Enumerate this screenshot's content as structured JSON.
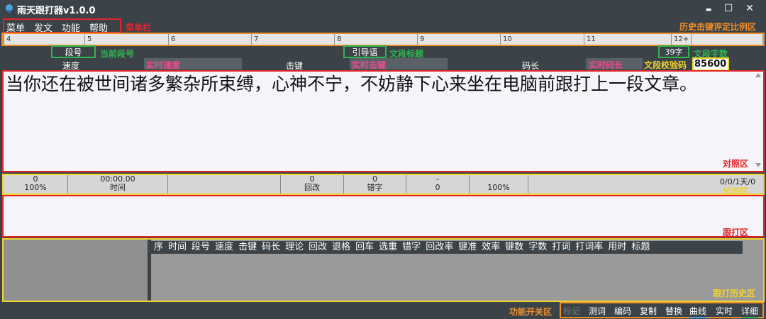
{
  "window": {
    "title": "雨天跟打器v1.0.0",
    "minimize": "▬",
    "maximize": "☐",
    "close": "✕",
    "menu_glyph": "▬"
  },
  "menu": {
    "items": [
      "菜单",
      "发文",
      "功能",
      "帮助"
    ]
  },
  "ruler": {
    "ticks": [
      "4",
      "5",
      "6",
      "7",
      "8",
      "9",
      "10",
      "11",
      "12+"
    ]
  },
  "info": {
    "segment_no": "段号",
    "guide": "引导语",
    "char_count": "39字",
    "check_code": "85600",
    "labels": {
      "speed": "速度",
      "keystroke": "击键",
      "code_len": "码长"
    }
  },
  "compare": {
    "text": "当你还在被世间诸多繁杂所束缚，心神不宁，不妨静下心来坐在电脑前跟打上一段文章。"
  },
  "status": {
    "c1_top": "0",
    "c1_bottom": "100%",
    "time_top": "00:00.00",
    "time_bottom": "时间",
    "back_top": "0",
    "back_bottom": "回改",
    "err_top": "0",
    "err_bottom": "错字",
    "c7_top": "-",
    "c7_bottom": "0",
    "c8_bottom": "100%",
    "right_top": "0/0/1天/0"
  },
  "history": {
    "columns": [
      "序",
      "时间",
      "段号",
      "速度",
      "击键",
      "码长",
      "理论",
      "回改",
      "退格",
      "回车",
      "选重",
      "错字",
      "回改率",
      "键准",
      "效率",
      "键数",
      "字数",
      "打词",
      "打词率",
      "用时",
      "标题"
    ]
  },
  "toggles": {
    "items": [
      "标记",
      "测词",
      "编码",
      "复制",
      "替换",
      "曲线",
      "实时",
      "详细"
    ]
  },
  "annotations": {
    "menubar": "菜单栏",
    "history_ratio": "历史击键评定比例区",
    "current_segment": "当前段号",
    "realtime_speed": "实时速度",
    "realtime_keystroke": "实时击键",
    "segment_title": "文段标题",
    "segment_count": "文段字数",
    "realtime_code_len": "实时码长",
    "check_code": "文段校验码",
    "compare_area": "对照区",
    "status_area": "状态区",
    "typing_area": "跟打区",
    "history_area": "跟打历史区",
    "toggle_area": "功能开关区"
  },
  "colors": {
    "red": "#e0262b",
    "orange": "#f0902a",
    "yellow": "#f2d22c",
    "green": "#2fb34f",
    "pink": "#e94b8c"
  }
}
